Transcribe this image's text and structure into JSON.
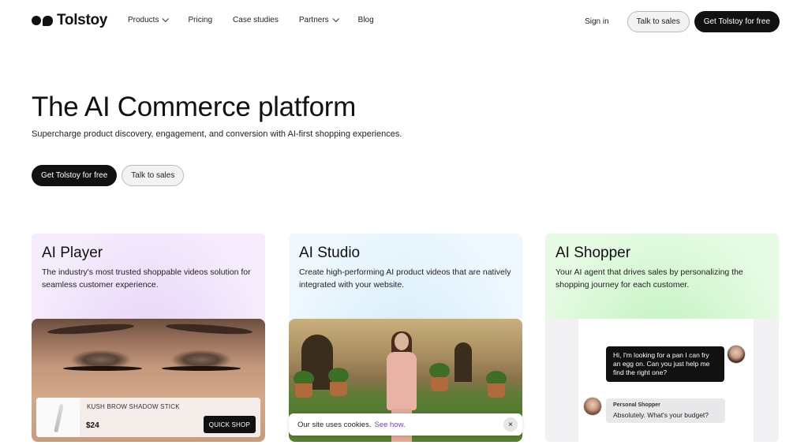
{
  "brand": {
    "name": "Tolstoy"
  },
  "nav": {
    "items": [
      {
        "label": "Products",
        "dropdown": true
      },
      {
        "label": "Pricing",
        "dropdown": false
      },
      {
        "label": "Case studies",
        "dropdown": false
      },
      {
        "label": "Partners",
        "dropdown": true
      },
      {
        "label": "Blog",
        "dropdown": false
      }
    ],
    "sign_in": "Sign in",
    "talk_to_sales": "Talk to sales",
    "get_free": "Get Tolstoy for free"
  },
  "hero": {
    "title": "The AI Commerce platform",
    "subtitle": "Supercharge product discovery, engagement, and conversion with AI-first shopping experiences.",
    "cta_primary": "Get Tolstoy for free",
    "cta_secondary": "Talk to sales"
  },
  "cards": [
    {
      "title": "AI Player",
      "description": "The industry's most trusted shoppable videos solution for seamless customer experience.",
      "product": {
        "name": "KUSH BROW SHADOW STICK",
        "price": "$24",
        "button": "QUICK SHOP"
      }
    },
    {
      "title": "AI Studio",
      "description": "Create high-performing AI product videos that are natively integrated with your website."
    },
    {
      "title": "AI Shopper",
      "description": "Your AI agent that drives sales by personalizing the shopping journey for each customer.",
      "chat": {
        "user_message": "Hi, I'm looking for a pan I can fry an egg on. Can you just help me find the right one?",
        "bot_name": "Personal Shopper",
        "bot_message": "Absolutely. What's your budget?"
      }
    }
  ],
  "cookie": {
    "text": "Our site uses cookies.",
    "link": "See how.",
    "close": "×"
  },
  "colors": {
    "accent_dark": "#111111",
    "link_purple": "#7a3ee6"
  }
}
